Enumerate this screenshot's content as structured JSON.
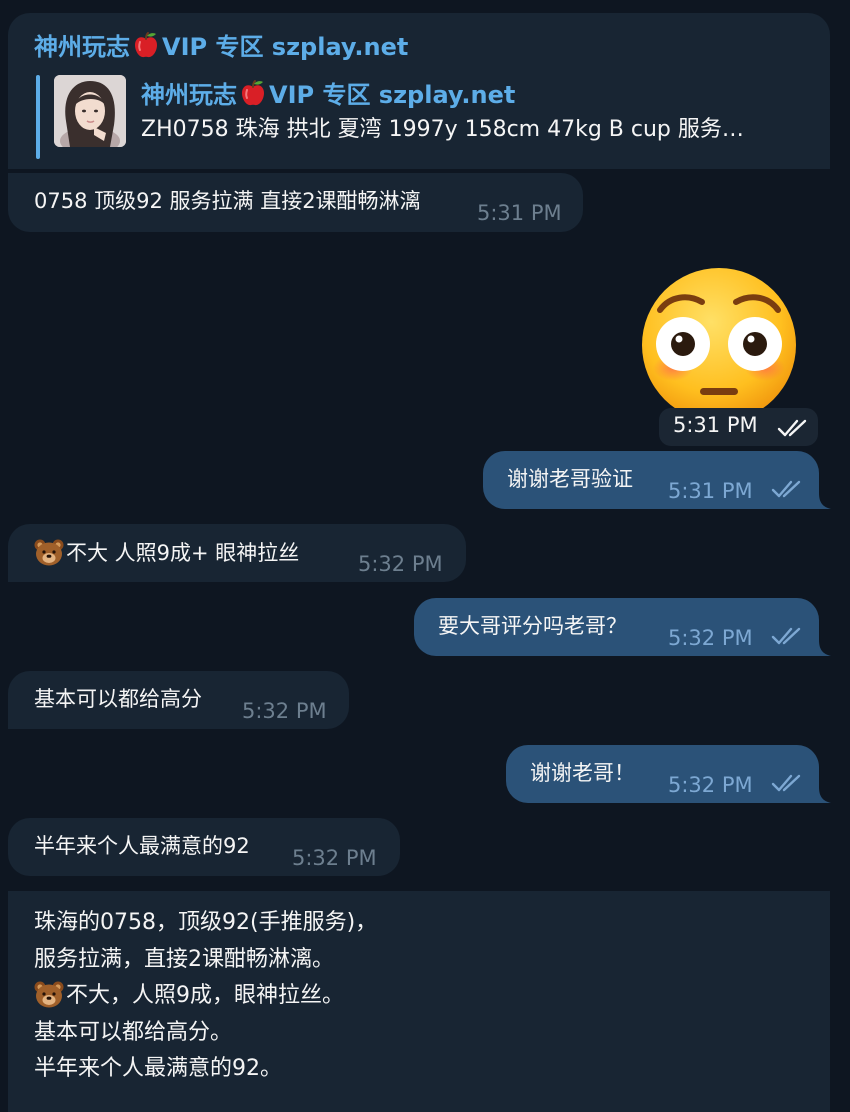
{
  "colors": {
    "background": "#0e1621",
    "incoming_bubble": "#182533",
    "outgoing_bubble": "#2b5278",
    "link_blue": "#5dade8"
  },
  "forward": {
    "channel": "神州玩志",
    "channel_suffix": "VIP 专区 szplay.net",
    "quote_title": "神州玩志",
    "quote_title_suffix": "VIP 专区 szplay.net",
    "quote_text": "ZH0758 珠海 拱北 夏湾 1997y  158cm  47kg  B cup  服务…"
  },
  "messages": [
    {
      "id": "m1",
      "dir": "in",
      "text": "0758  顶级92 服务拉满 直接2课酣畅淋漓",
      "time": "5:31 PM"
    },
    {
      "id": "sticker",
      "dir": "out",
      "sticker": "flushed-face-emoji",
      "time": "5:31 PM"
    },
    {
      "id": "m2",
      "dir": "out",
      "text": "谢谢老哥验证",
      "time": "5:31 PM"
    },
    {
      "id": "m3",
      "dir": "in",
      "text": "不大  人照9成+   眼神拉丝",
      "time": "5:32 PM"
    },
    {
      "id": "m4",
      "dir": "out",
      "text": "要大哥评分吗老哥？",
      "time": "5:32 PM"
    },
    {
      "id": "m5",
      "dir": "in",
      "text": "基本可以都给高分",
      "time": "5:32 PM"
    },
    {
      "id": "m6",
      "dir": "out",
      "text": "谢谢老哥！",
      "time": "5:32 PM"
    },
    {
      "id": "m7",
      "dir": "in",
      "text": "半年来个人最满意的92",
      "time": "5:32 PM"
    }
  ],
  "summary": {
    "lines": [
      "珠海的0758，顶级92(手推服务)，",
      "服务拉满，直接2课酣畅淋漓。",
      "不大，人照9成，眼神拉丝。",
      "基本可以都给高分。",
      "半年来个人最满意的92。"
    ]
  }
}
